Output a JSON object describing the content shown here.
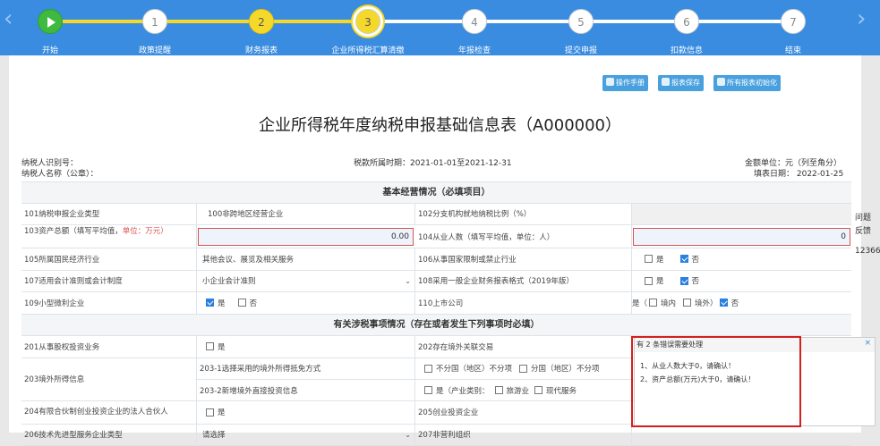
{
  "nav": {
    "prev": "‹",
    "next": "›"
  },
  "steps": [
    {
      "num": "",
      "label": "开始"
    },
    {
      "num": "1",
      "label": "政策提醒"
    },
    {
      "num": "2",
      "label": "财务报表"
    },
    {
      "num": "3",
      "label": "企业所得税汇算清缴"
    },
    {
      "num": "4",
      "label": "年报检查"
    },
    {
      "num": "5",
      "label": "提交申报"
    },
    {
      "num": "6",
      "label": "扣款信息"
    },
    {
      "num": "7",
      "label": "结束"
    }
  ],
  "toolbar": {
    "manual": "操作手册",
    "save": "报表保存",
    "init": "所有报表初始化"
  },
  "title": "企业所得税年度纳税申报基础信息表（A000000）",
  "meta": {
    "taxpayer_id": "纳税人识别号：",
    "taxpayer_name": "纳税人名称（公章）：",
    "period": "税款所属时期：2021-01-01至2021-12-31",
    "unit": "金额单位：元（列至角分）",
    "date": "填表日期： 2022-01-25"
  },
  "section1": "基本经营情况（必填项目）",
  "section2": "有关涉税事项情况（存在或者发生下列事项时必填）",
  "rows": {
    "r101": "101纳税申报企业类型",
    "r101v": "100非跨地区经营企业",
    "r102": "102分支机构就地纳税比例（%）",
    "r103a": "103资产总额（填写平均值，",
    "r103b": "单位：万元",
    "r103c": "）",
    "r103v": "0.00",
    "r104": "104从业人数（填写平均值，单位：人）",
    "r104v": "0",
    "r105": "105所属国民经济行业",
    "r105v": "其他会议、展览及相关服务",
    "r106": "106从事国家限制或禁止行业",
    "r107": "107适用会计准则或会计制度",
    "r107v": "小企业会计准则",
    "r108": "108采用一般企业财务报表格式（2019年版）",
    "r109": "109小型微利企业",
    "r110": "110上市公司",
    "r201": "201从事股权投资业务",
    "r202": "202存在境外关联交易",
    "r203": "203境外所得信息",
    "r2031": "203-1选择采用的境外所得抵免方式",
    "r2031opt": "不分国（地区）不分项",
    "r2031opt2": "分国（地区）不分项",
    "r2032": "203-2新增境外直接投资信息",
    "r2032opt": "是（产业类别：",
    "r2032opt2": "旅游业",
    "r2032opt3": "现代服务",
    "r204": "204有限合伙制创业投资企业的法人合伙人",
    "r205": "205创业投资企业",
    "r206": "206技术先进型服务企业类型",
    "r206v": "请选择",
    "r207": "207非营利组织"
  },
  "opts": {
    "yes": "是",
    "no": "否",
    "inside": "境内",
    "outside": "境外",
    "listed_prefix": "是（",
    "listed_suffix": "）"
  },
  "side": {
    "q": "问题",
    "fb": "反馈",
    "num": "12366"
  },
  "popup": {
    "title": "有 2 条错误需要处理",
    "close": "×",
    "m1": "1、从业人数大于0，请确认！",
    "m2": "2、资产总额(万元)大于0，请确认！"
  }
}
